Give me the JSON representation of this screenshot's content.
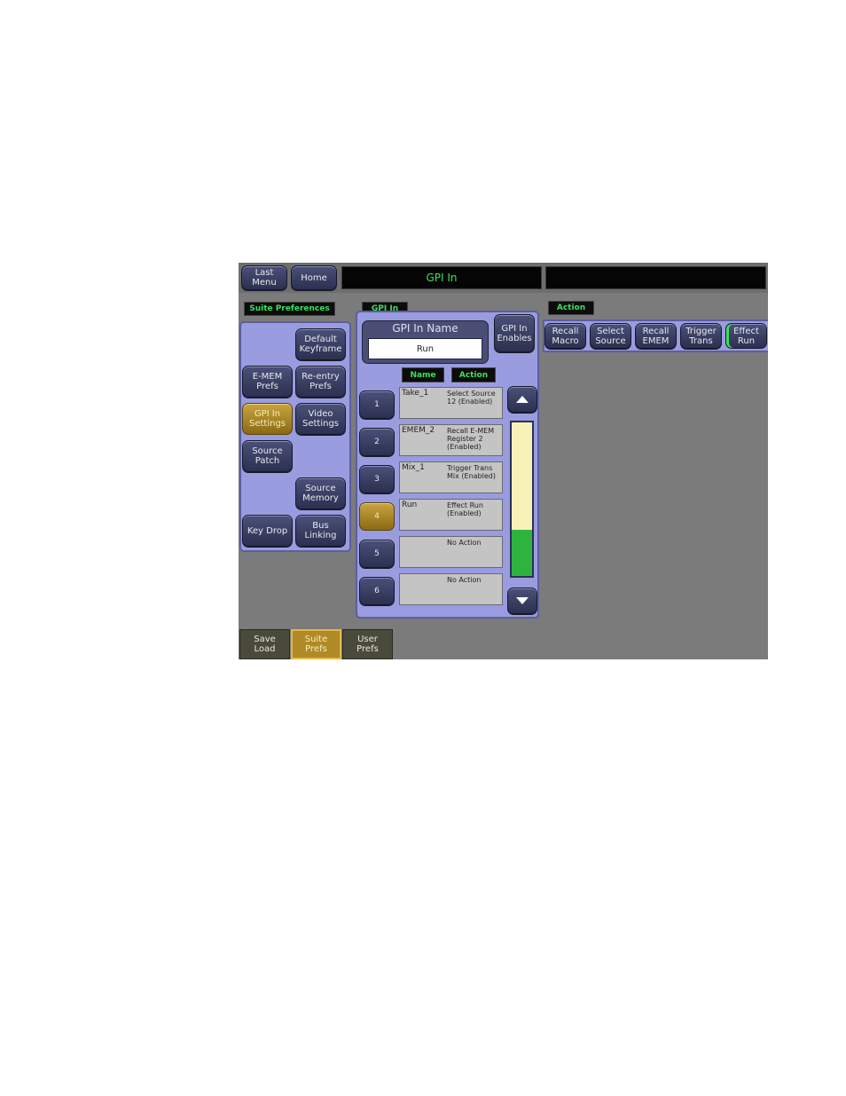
{
  "header": {
    "last_menu": "Last\nMenu",
    "home": "Home",
    "title": "GPI In",
    "status": ""
  },
  "suite_prefs": {
    "tab_label": "Suite Preferences",
    "buttons": {
      "default_keyframe": "Default\nKeyframe",
      "emem_prefs": "E-MEM\nPrefs",
      "reentry_prefs": "Re-entry\nPrefs",
      "gpi_in_settings": "GPI In\nSettings",
      "video_settings": "Video\nSettings",
      "source_patch": "Source\nPatch",
      "source_memory": "Source\nMemory",
      "key_drop": "Key Drop",
      "bus_linking": "Bus\nLinking"
    }
  },
  "gpi_in": {
    "tab_label": "GPI In",
    "name_label": "GPI In Name",
    "name_value": "Run",
    "enables": "GPI In\nEnables",
    "col_name": "Name",
    "col_action": "Action",
    "scroll_fill_fraction": 0.3,
    "rows": [
      {
        "num": "1",
        "name": "Take_1",
        "action": "Select Source 12 (Enabled)",
        "selected": false
      },
      {
        "num": "2",
        "name": "EMEM_2",
        "action": "Recall E-MEM Register 2 (Enabled)",
        "selected": false
      },
      {
        "num": "3",
        "name": "Mix_1",
        "action": "Trigger Trans Mix (Enabled)",
        "selected": false
      },
      {
        "num": "4",
        "name": "Run",
        "action": "Effect Run (Enabled)",
        "selected": true
      },
      {
        "num": "5",
        "name": "",
        "action": "No Action",
        "selected": false
      },
      {
        "num": "6",
        "name": "",
        "action": "No Action",
        "selected": false
      }
    ]
  },
  "action": {
    "tab_label": "Action",
    "buttons": [
      {
        "label": "Recall\nMacro",
        "selected": false
      },
      {
        "label": "Select\nSource",
        "selected": false
      },
      {
        "label": "Recall\nEMEM",
        "selected": false
      },
      {
        "label": "Trigger\nTrans",
        "selected": false
      },
      {
        "label": "Effect\nRun",
        "selected": true
      }
    ]
  },
  "bottom_tabs": [
    {
      "label": "Save\nLoad",
      "active": false
    },
    {
      "label": "Suite\nPrefs",
      "active": true
    },
    {
      "label": "User\nPrefs",
      "active": false
    }
  ],
  "colors": {
    "panel": "#9a9ce0",
    "accent_green": "#3ae05a",
    "selected_gold": "#c9a43e"
  }
}
